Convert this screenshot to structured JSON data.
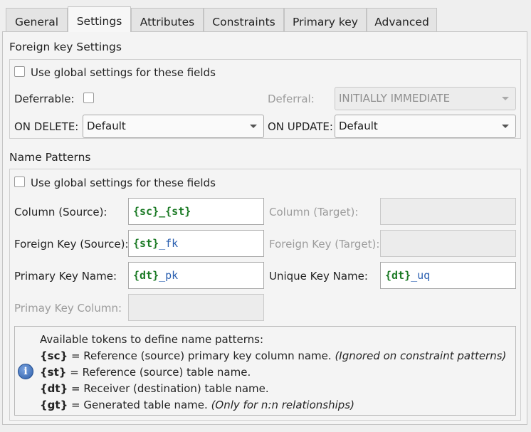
{
  "tabs": [
    "General",
    "Settings",
    "Attributes",
    "Constraints",
    "Primary key",
    "Advanced"
  ],
  "active_tab": "Settings",
  "fk_settings": {
    "title": "Foreign key Settings",
    "use_global_label": "Use global settings for these fields",
    "use_global_checked": false,
    "deferrable_label": "Deferrable:",
    "deferrable_checked": false,
    "deferral_label": "Deferral:",
    "deferral_value": "INITIALLY IMMEDIATE",
    "on_delete_label": "ON DELETE:",
    "on_delete_value": "Default",
    "on_update_label": "ON UPDATE:",
    "on_update_value": "Default"
  },
  "name_patterns": {
    "title": "Name Patterns",
    "use_global_label": "Use global settings for these fields",
    "use_global_checked": false,
    "column_source_label": "Column (Source):",
    "column_source_token": "{sc}_{st}",
    "column_source_suffix": "",
    "column_target_label": "Column (Target):",
    "column_target_value": "",
    "fk_source_label": "Foreign Key (Source):",
    "fk_source_token": "{st}",
    "fk_source_suffix": "_fk",
    "fk_target_label": "Foreign Key (Target):",
    "fk_target_value": "",
    "pk_name_label": "Primary Key Name:",
    "pk_name_token": "{dt}",
    "pk_name_suffix": "_pk",
    "uq_name_label": "Unique Key Name:",
    "uq_name_token": "{dt}",
    "uq_name_suffix": "_uq",
    "pk_column_label": "Primay Key Column:",
    "pk_column_value": ""
  },
  "tokens_info": {
    "heading": "Available tokens to define name patterns:",
    "items": [
      {
        "token": "{sc}",
        "text": " = Reference (source) primary key column name. ",
        "note": "(Ignored on constraint patterns)"
      },
      {
        "token": "{st}",
        "text": " = Reference (source) table name.",
        "note": ""
      },
      {
        "token": "{dt}",
        "text": " = Receiver (destination) table name.",
        "note": ""
      },
      {
        "token": "{gt}",
        "text": " = Generated table name. ",
        "note": "(Only for n:n relationships)"
      }
    ]
  },
  "colors": {
    "token_green": "#1b7a25",
    "suffix_blue": "#2a5fb0",
    "info_blue": "#2d5ea8"
  }
}
